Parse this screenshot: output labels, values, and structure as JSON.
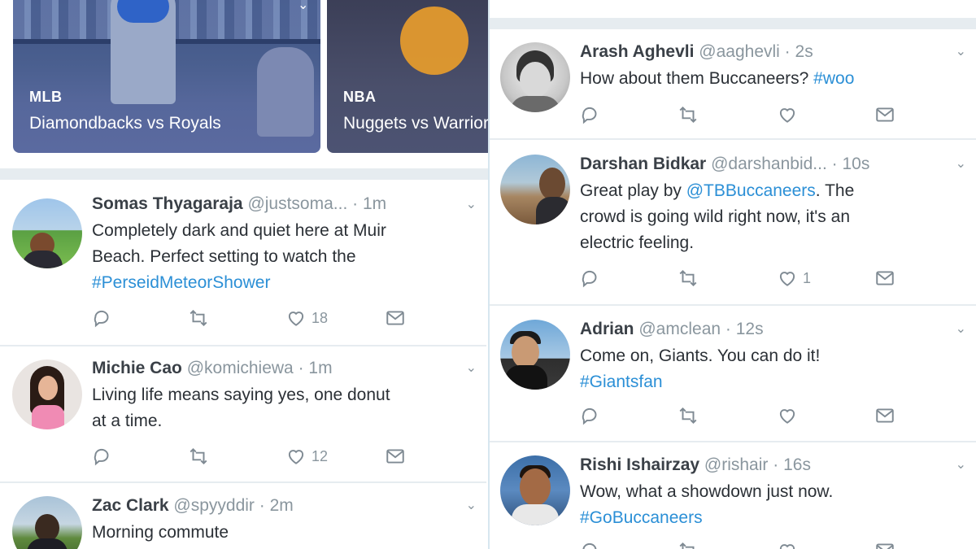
{
  "cards": [
    {
      "league": "MLB",
      "title": "Diamondbacks vs Royals"
    },
    {
      "league": "NBA",
      "title": "Nuggets vs Warriors"
    }
  ],
  "left_tweets": [
    {
      "name": "Somas Thyagaraja",
      "handle": "@justsoma...",
      "time": "1m",
      "text_plain": "Completely dark and quiet here at Muir\nBeach. Perfect setting to watch the\n",
      "link": "#PerseidMeteorShower",
      "likes": "18"
    },
    {
      "name": "Michie Cao",
      "handle": "@komichiewa",
      "time": "1m",
      "text_plain": "Living life means saying yes, one donut\nat a time.",
      "link": "",
      "likes": "12"
    },
    {
      "name": "Zac Clark",
      "handle": "@spyyddir",
      "time": "2m",
      "text_plain": "Morning commute",
      "link": "",
      "likes": ""
    }
  ],
  "right_tweets": [
    {
      "name": "Arash Aghevli",
      "handle": "@aaghevli",
      "time": "2s",
      "text_plain": "How about them Buccaneers? ",
      "link": "#woo",
      "text_after": "",
      "likes": ""
    },
    {
      "name": "Darshan Bidkar",
      "handle": "@darshanbid...",
      "time": "10s",
      "text_plain": "Great play by ",
      "link": "@TBBuccaneers",
      "text_after": ". The\ncrowd is going wild right now, it's an\nelectric feeling.",
      "likes": "1"
    },
    {
      "name": "Adrian",
      "handle": "@amclean",
      "time": "12s",
      "text_plain": "Come on, Giants. You can do it!\n",
      "link": "#Giantsfan",
      "text_after": "",
      "likes": ""
    },
    {
      "name": "Rishi Ishairzay",
      "handle": "@rishair",
      "time": "16s",
      "text_plain": "Wow, what a showdown just now.\n",
      "link": "#GoBuccaneers",
      "text_after": "",
      "likes": ""
    }
  ],
  "separator": "·",
  "icons": [
    "reply-icon",
    "retweet-icon",
    "like-icon",
    "direct-message-icon",
    "chevron-down-icon"
  ],
  "colors": {
    "link": "#2b8fd6",
    "muted": "#8a969e",
    "divider": "#e6ecf0"
  }
}
